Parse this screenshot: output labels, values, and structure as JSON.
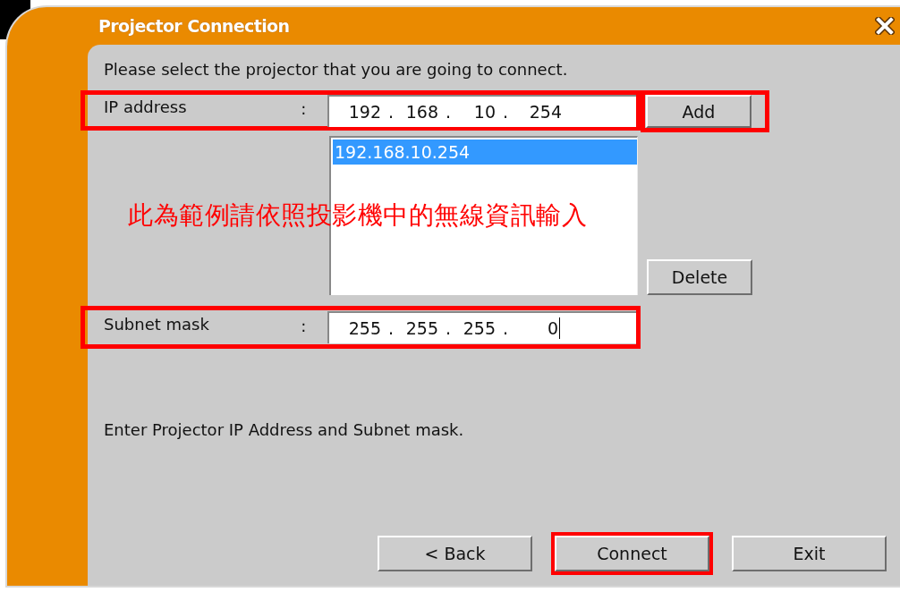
{
  "window": {
    "title": "Projector Connection"
  },
  "prompt": "Please select the projector that you are going to connect.",
  "ip_address": {
    "label": "IP address",
    "colon": ":",
    "octets": [
      "192",
      "168",
      "10",
      "254"
    ],
    "separator": ".",
    "focused": false,
    "highlighted": true
  },
  "add_button": {
    "label": "Add",
    "highlighted": true
  },
  "projector_list": [
    {
      "text": "192.168.10.254",
      "selected": true
    }
  ],
  "delete_button": {
    "label": "Delete",
    "highlighted": false
  },
  "subnet_mask": {
    "label": "Subnet mask",
    "colon": ":",
    "octets": [
      "255",
      "255",
      "255",
      "0"
    ],
    "separator": ".",
    "focused": true,
    "highlighted": true
  },
  "annotation_note": "此為範例請依照投影機中的無線資訊輸入",
  "hint": "Enter Projector IP Address and Subnet mask.",
  "buttons": [
    {
      "label": "< Back",
      "highlighted": false
    },
    {
      "label": "Connect",
      "highlighted": true
    },
    {
      "label": "Exit",
      "highlighted": false
    }
  ]
}
